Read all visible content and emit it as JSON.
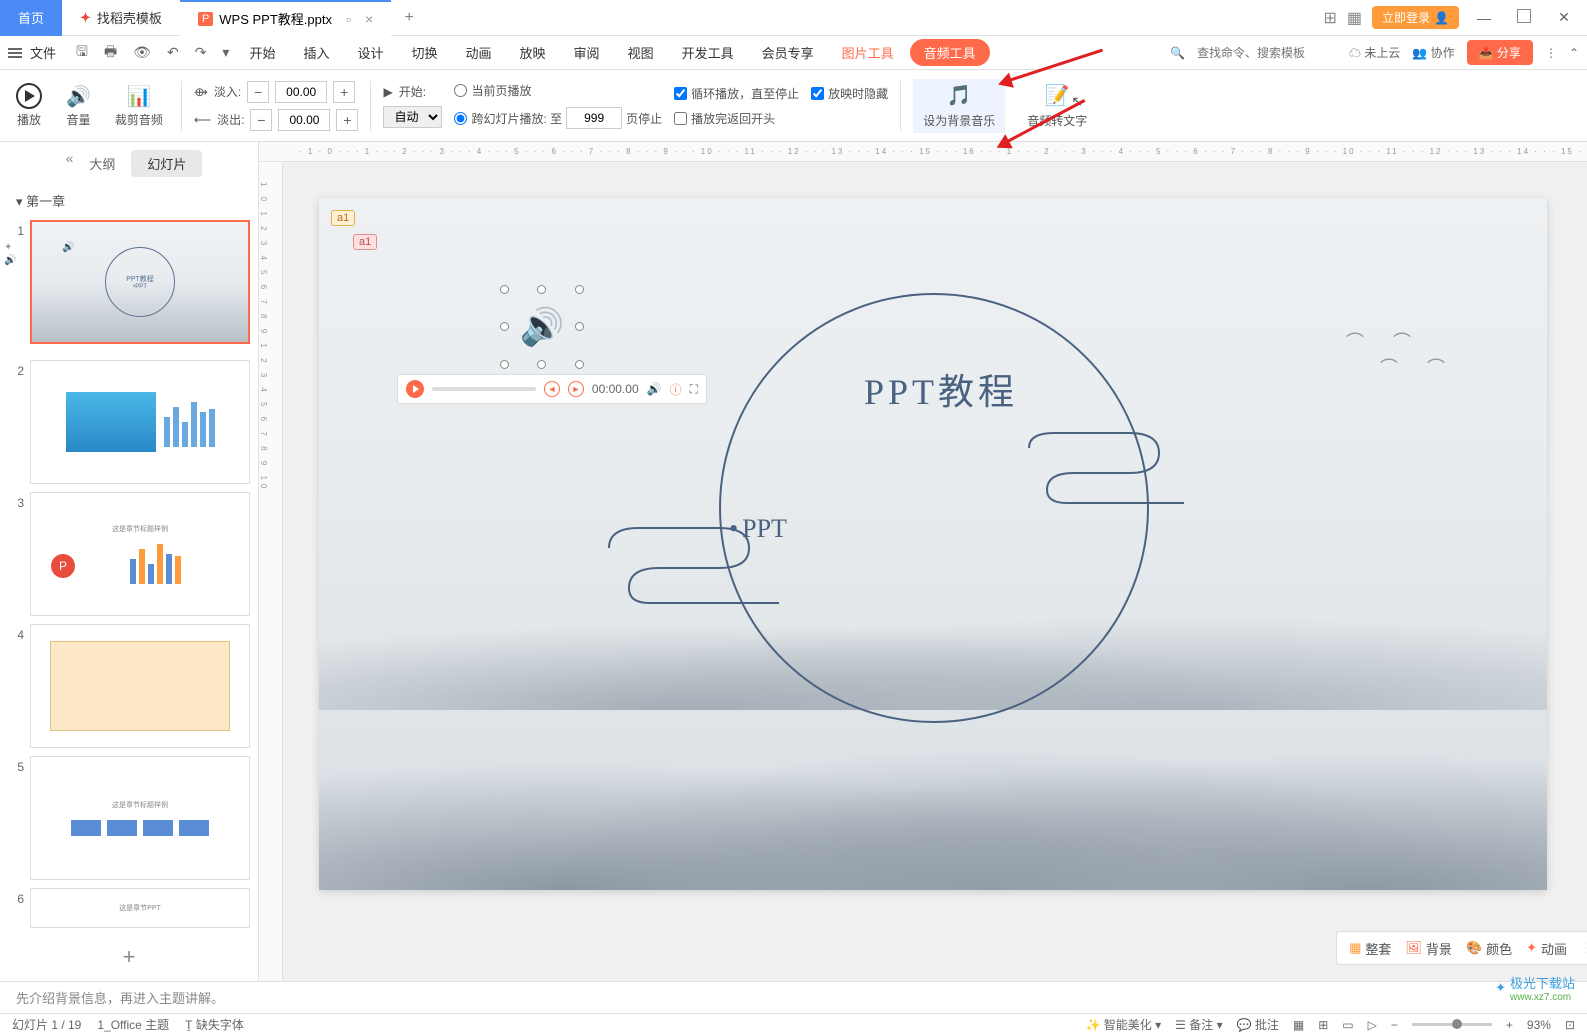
{
  "tabs": {
    "home": "首页",
    "template": "找稻壳模板",
    "active_icon": "P",
    "active": "WPS PPT教程.pptx"
  },
  "titlebar": {
    "login": "立即登录"
  },
  "menubar": {
    "file": "文件",
    "items": [
      "开始",
      "插入",
      "设计",
      "切换",
      "动画",
      "放映",
      "审阅",
      "视图",
      "开发工具",
      "会员专享"
    ],
    "pic_tool": "图片工具",
    "audio_tool": "音频工具",
    "search_placeholder": "查找命令、搜索模板",
    "cloud": "未上云",
    "collab": "协作",
    "share": "分享"
  },
  "ribbon": {
    "play": "播放",
    "volume": "音量",
    "trim": "裁剪音频",
    "fade_in": "淡入:",
    "fade_out": "淡出:",
    "fade_in_val": "00.00",
    "fade_out_val": "00.00",
    "start": "开始:",
    "auto": "自动",
    "current_slide": "当前页播放",
    "cross_slide": "跨幻灯片播放: 至",
    "cross_val": "999",
    "page_stop": "页停止",
    "loop": "循环播放，直至停止",
    "hide": "放映时隐藏",
    "return": "播放完返回开头",
    "bg_music": "设为背景音乐",
    "to_text": "音频转文字"
  },
  "outline": {
    "tab_outline": "大纲",
    "tab_slides": "幻灯片",
    "chapter": "第一章",
    "thumb1_title": "PPT教程",
    "thumb1_sub": "PPT",
    "thumb3_title": "这是章节标题样例",
    "thumb5_title": "这是章节标题样例",
    "thumb6_title": "这是章节PPT",
    "nums": [
      "1",
      "2",
      "3",
      "4",
      "5",
      "6"
    ]
  },
  "slide": {
    "title": "PPT教程",
    "subtitle": "PPT",
    "comment1": "a1",
    "comment2": "a1",
    "audio_time": "00:00.00"
  },
  "float_toolbar": {
    "theme": "整套",
    "bg": "背景",
    "color": "颜色",
    "anim": "动画"
  },
  "notes": "先介绍背景信息，再进入主题讲解。",
  "status": {
    "slide": "幻灯片 1 / 19",
    "theme": "1_Office 主题",
    "font": "缺失字体",
    "beautify": "智能美化",
    "notes_btn": "备注",
    "comment_btn": "批注",
    "zoom": "93%"
  },
  "watermark": {
    "name": "极光下载站",
    "url": "www.xz7.com"
  }
}
